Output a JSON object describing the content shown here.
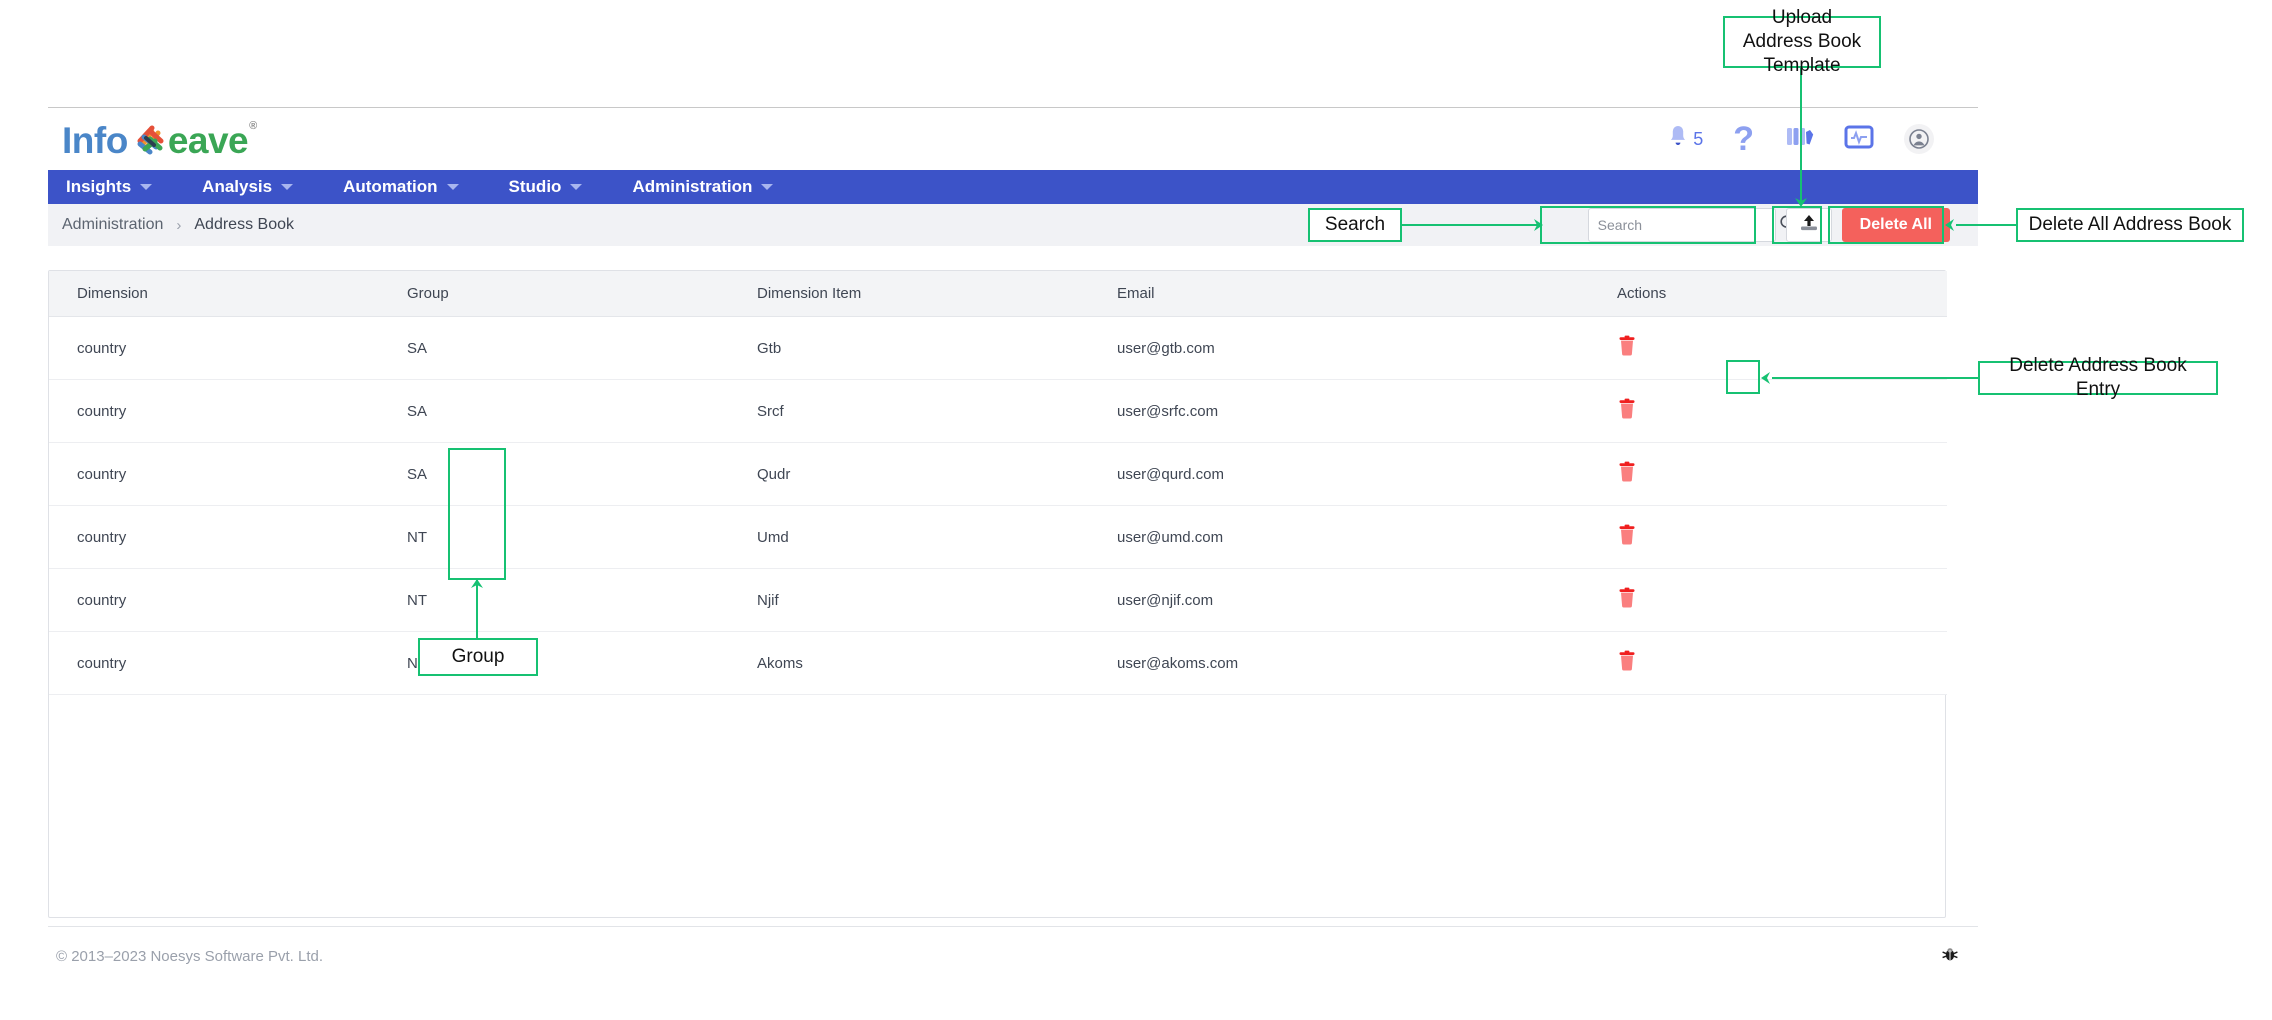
{
  "brand": {
    "name_part1": "Info",
    "name_part2": "eave",
    "registered": "®"
  },
  "header": {
    "notification_count": "5",
    "icons": [
      "bell-icon",
      "help-icon",
      "library-icon",
      "monitor-icon",
      "user-avatar-icon"
    ]
  },
  "nav": {
    "items": [
      {
        "label": "Insights"
      },
      {
        "label": "Analysis"
      },
      {
        "label": "Automation"
      },
      {
        "label": "Studio"
      },
      {
        "label": "Administration"
      }
    ]
  },
  "breadcrumb": {
    "parent": "Administration",
    "separator": "›",
    "current": "Address Book"
  },
  "toolbar": {
    "search_placeholder": "Search",
    "search_value": "",
    "upload_label": "",
    "delete_all_label": "Delete All"
  },
  "table": {
    "columns": [
      "Dimension",
      "Group",
      "Dimension Item",
      "Email",
      "Actions"
    ],
    "rows": [
      {
        "dimension": "country",
        "group": "SA",
        "item": "Gtb",
        "email": "user@gtb.com"
      },
      {
        "dimension": "country",
        "group": "SA",
        "item": "Srcf",
        "email": "user@srfc.com"
      },
      {
        "dimension": "country",
        "group": "SA",
        "item": "Qudr",
        "email": "user@qurd.com"
      },
      {
        "dimension": "country",
        "group": "NT",
        "item": "Umd",
        "email": "user@umd.com"
      },
      {
        "dimension": "country",
        "group": "NT",
        "item": "Njif",
        "email": "user@njif.com"
      },
      {
        "dimension": "country",
        "group": "NT",
        "item": "Akoms",
        "email": "user@akoms.com"
      }
    ]
  },
  "footer": {
    "copyright": "© 2013–2023 Noesys Software Pvt. Ltd.",
    "debug_icon": "bug-icon"
  },
  "annotations": {
    "upload": "Upload Address Book Template",
    "search": "Search",
    "delete_all": "Delete All Address Book",
    "delete_entry": "Delete Address Book Entry",
    "group": "Group",
    "accent_color": "#16c172"
  }
}
